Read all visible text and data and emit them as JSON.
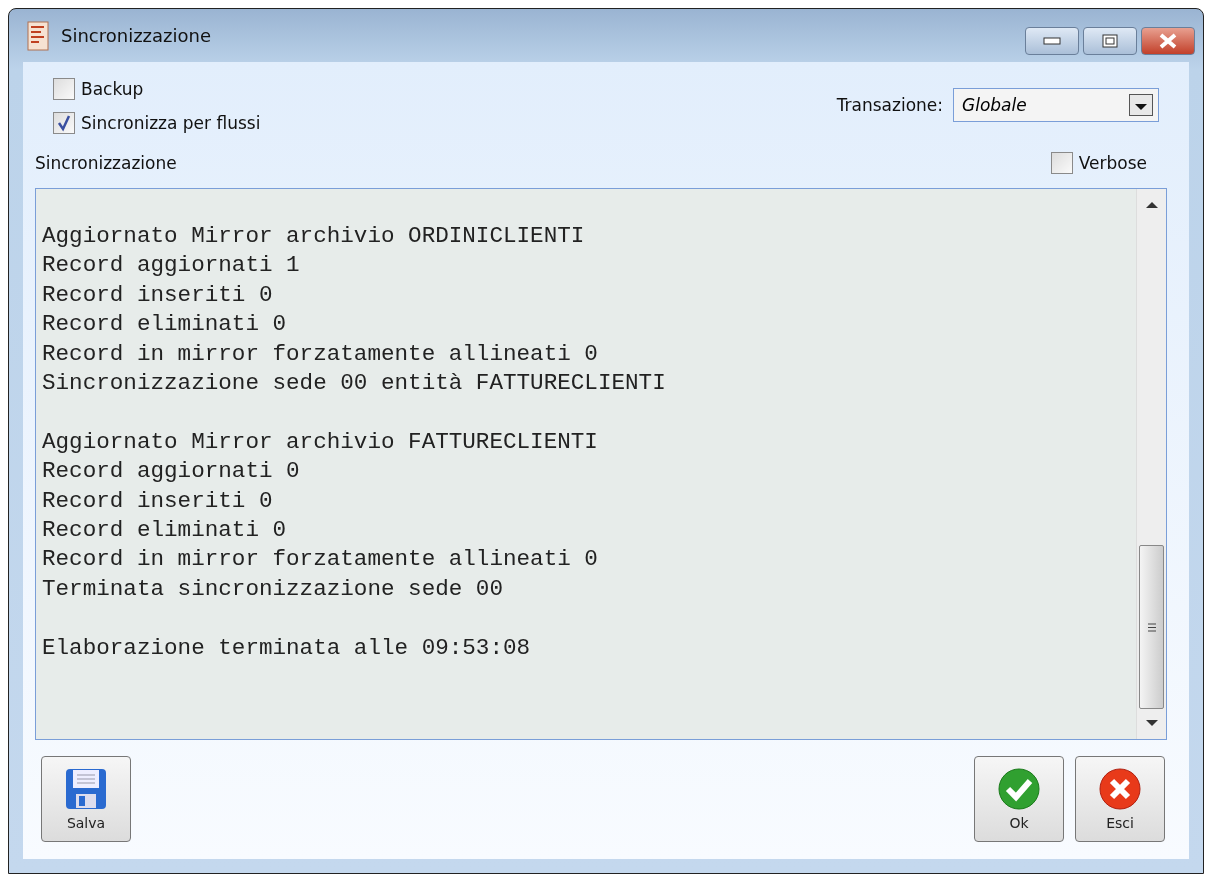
{
  "window": {
    "title": "Sincronizzazione"
  },
  "options": [
    {
      "label": "Backup",
      "checked": false
    },
    {
      "label": "Sincronizza per flussi",
      "checked": true
    }
  ],
  "transaction": {
    "label": "Transazione:",
    "value": "Globale"
  },
  "log_label": "Sincronizzazione",
  "verbose": {
    "label": "Verbose",
    "checked": false
  },
  "log_blocks": [
    {
      "lines": [
        "Aggiornato Mirror archivio ORDINICLIENTI",
        "Record aggiornati 1",
        "Record inseriti 0",
        "Record eliminati 0",
        "Record in mirror forzatamente allineati 0",
        "Sincronizzazione sede 00 entità FATTURECLIENTI"
      ]
    },
    {
      "lines": [
        "Aggiornato Mirror archivio FATTURECLIENTI",
        "Record aggiornati 0",
        "Record inseriti 0",
        "Record eliminati 0",
        "Record in mirror forzatamente allineati 0",
        "Terminata sincronizzazione sede 00"
      ]
    },
    {
      "lines": [
        "Elaborazione terminata alle 09:53:08"
      ]
    }
  ],
  "buttons": [
    {
      "kind": "save",
      "label": "Salva"
    },
    {
      "kind": "ok",
      "label": "Ok"
    },
    {
      "kind": "exit",
      "label": "Esci"
    }
  ]
}
